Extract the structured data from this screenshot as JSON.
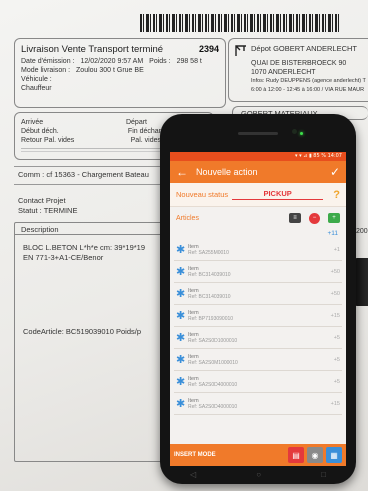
{
  "document": {
    "header_title": "Livraison Vente Transport terminé",
    "doc_number": "2394",
    "date_label": "Date d'émission :",
    "date_value": "12/02/2020 9:57 AM",
    "poids_label": "Poids :",
    "poids_value": "298 58 t",
    "mode_label": "Mode livraison :",
    "mode_value": "Zoulou 300 t Grue BE",
    "vehicule_label": "Véhicule :",
    "chauffeur_label": "Chauffeur",
    "depot_title": "Dépot GOBERT ANDERLECHT",
    "depot_addr1": "QUAI DE BISTERBROECK 90",
    "depot_addr2": "1070      ANDERLECHT",
    "depot_addr3": "Infos: Rudy DEUPPENS (agence anderlecht) T",
    "depot_addr4": "6:00 à 12:00 - 12:45 à 16:00 / VIA RUE MAUR",
    "arrivee_label": "Arrivée",
    "depart_label": "Départ",
    "debut_dech_label": "Début déch.",
    "fin_dech_label": "Fin déchar",
    "retour_label": "Retour Pal. vides",
    "pal_vides_label": "Pal. vides",
    "gobert_materiaux": "GOBERT MATERIAUX",
    "comm_line": "Comm : cf 15363 - Chargement Bateau",
    "contact_label": "Contact Projet",
    "statut_label": "Statut : TERMINE",
    "description_header": "Description",
    "desc_line1": "BLOC L.BETON L*h*e cm: 39*19*19",
    "desc_line2": "EN 771-3+A1-CE/Benor",
    "code_article_line": "CodeArticle: BC519039010  Poids/p",
    "side_number": "200"
  },
  "phone": {
    "status_bar_text": "▾ ▾ ⊿ ▮ 85 % 14:07",
    "app_title": "Nouvelle action",
    "back_icon": "←",
    "confirm_icon": "✓",
    "status_label": "Nouveau status",
    "status_value": "PICKUP",
    "help_icon": "?",
    "articles_label": "Articles",
    "articles_count": "+11",
    "items": [
      {
        "name": "Item",
        "ref": "Ref: SA255M0010",
        "qty": "+1"
      },
      {
        "name": "Item",
        "ref": "Ref: BC314039010",
        "qty": "+50"
      },
      {
        "name": "Item",
        "ref": "Ref: BC314039010",
        "qty": "+50"
      },
      {
        "name": "Item",
        "ref": "Ref: BP7193090010",
        "qty": "+15"
      },
      {
        "name": "Item",
        "ref": "Ref: SA2S0D1000010",
        "qty": "+5"
      },
      {
        "name": "Item",
        "ref": "Ref: SA2S0M1000010",
        "qty": "+5"
      },
      {
        "name": "Item",
        "ref": "Ref: SA2S0D4000010",
        "qty": "+5"
      },
      {
        "name": "Item",
        "ref": "Ref: SA2S0D4000010",
        "qty": "+15"
      }
    ],
    "bottom_mode_label": "INSERT MODE",
    "colors": {
      "accent": "#f07a2a",
      "status_value": "#e4393c",
      "item_star": "#3a8fd9"
    }
  }
}
